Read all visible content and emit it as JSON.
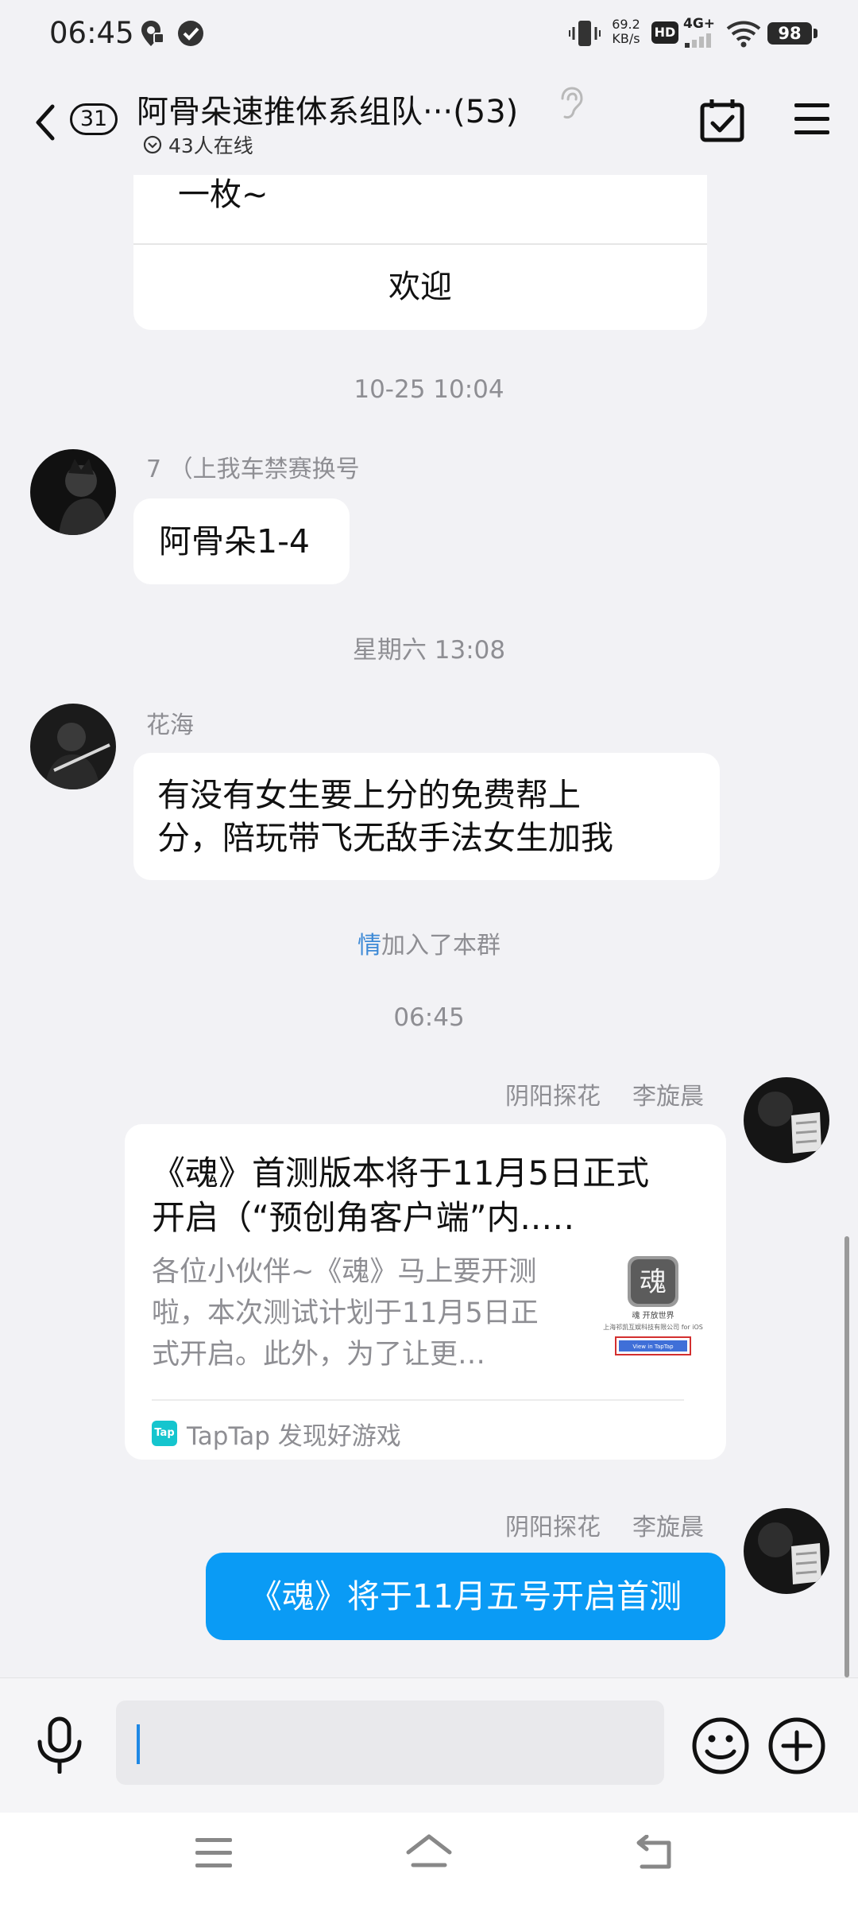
{
  "status_bar": {
    "time": "06:45",
    "network_speed_value": "69.2",
    "network_speed_unit": "KB/s",
    "hd_label": "HD",
    "network_type": "4G+",
    "battery": "98"
  },
  "header": {
    "back_badge": "31",
    "title": "阿骨朵速推体系组队···(53)",
    "online": "43人在线"
  },
  "messages": {
    "card_top": {
      "text": "一枚~",
      "button_label": "欢迎"
    },
    "ts1": "10-25 10:04",
    "msg1": {
      "sender": "7 （上我车禁赛换号",
      "text": "阿骨朵1-4"
    },
    "ts2": "星期六 13:08",
    "msg2": {
      "sender": "花海",
      "line1": "有没有女生要上分的免费帮上",
      "line2": "分，陪玩带飞无敌手法女生加我"
    },
    "system": {
      "name": "情",
      "action": "加入了本群"
    },
    "ts3": "06:45",
    "msg3": {
      "sender_title": "阴阳探花",
      "sender_name": "李旋晨",
      "share_title_line1": "《魂》首测版本将于11月5日正式",
      "share_title_line2": "开启（“预创角客户端”内..…",
      "share_desc_line1": "各位小伙伴~《魂》马上要开测",
      "share_desc_line2": "啦，本次测试计划于11月5日正",
      "share_desc_line3": "式开启。此外，为了让更…",
      "thumb_char": "魂",
      "thumb_caption": "魂 开放世界",
      "thumb_company": "上海祁凯互娱科技有限公司 for iOS",
      "thumb_button": "View in TapTap",
      "source_logo": "Tap",
      "source": "TapTap 发现好游戏"
    },
    "msg4": {
      "sender_title": "阴阳探花",
      "sender_name": "李旋晨",
      "text": "《魂》将于11月五号开启首测"
    }
  },
  "input": {
    "value": "",
    "placeholder": ""
  },
  "colors": {
    "accent": "#0a9bf5",
    "background": "#f2f2f5",
    "system_name": "#3e8ad6"
  }
}
